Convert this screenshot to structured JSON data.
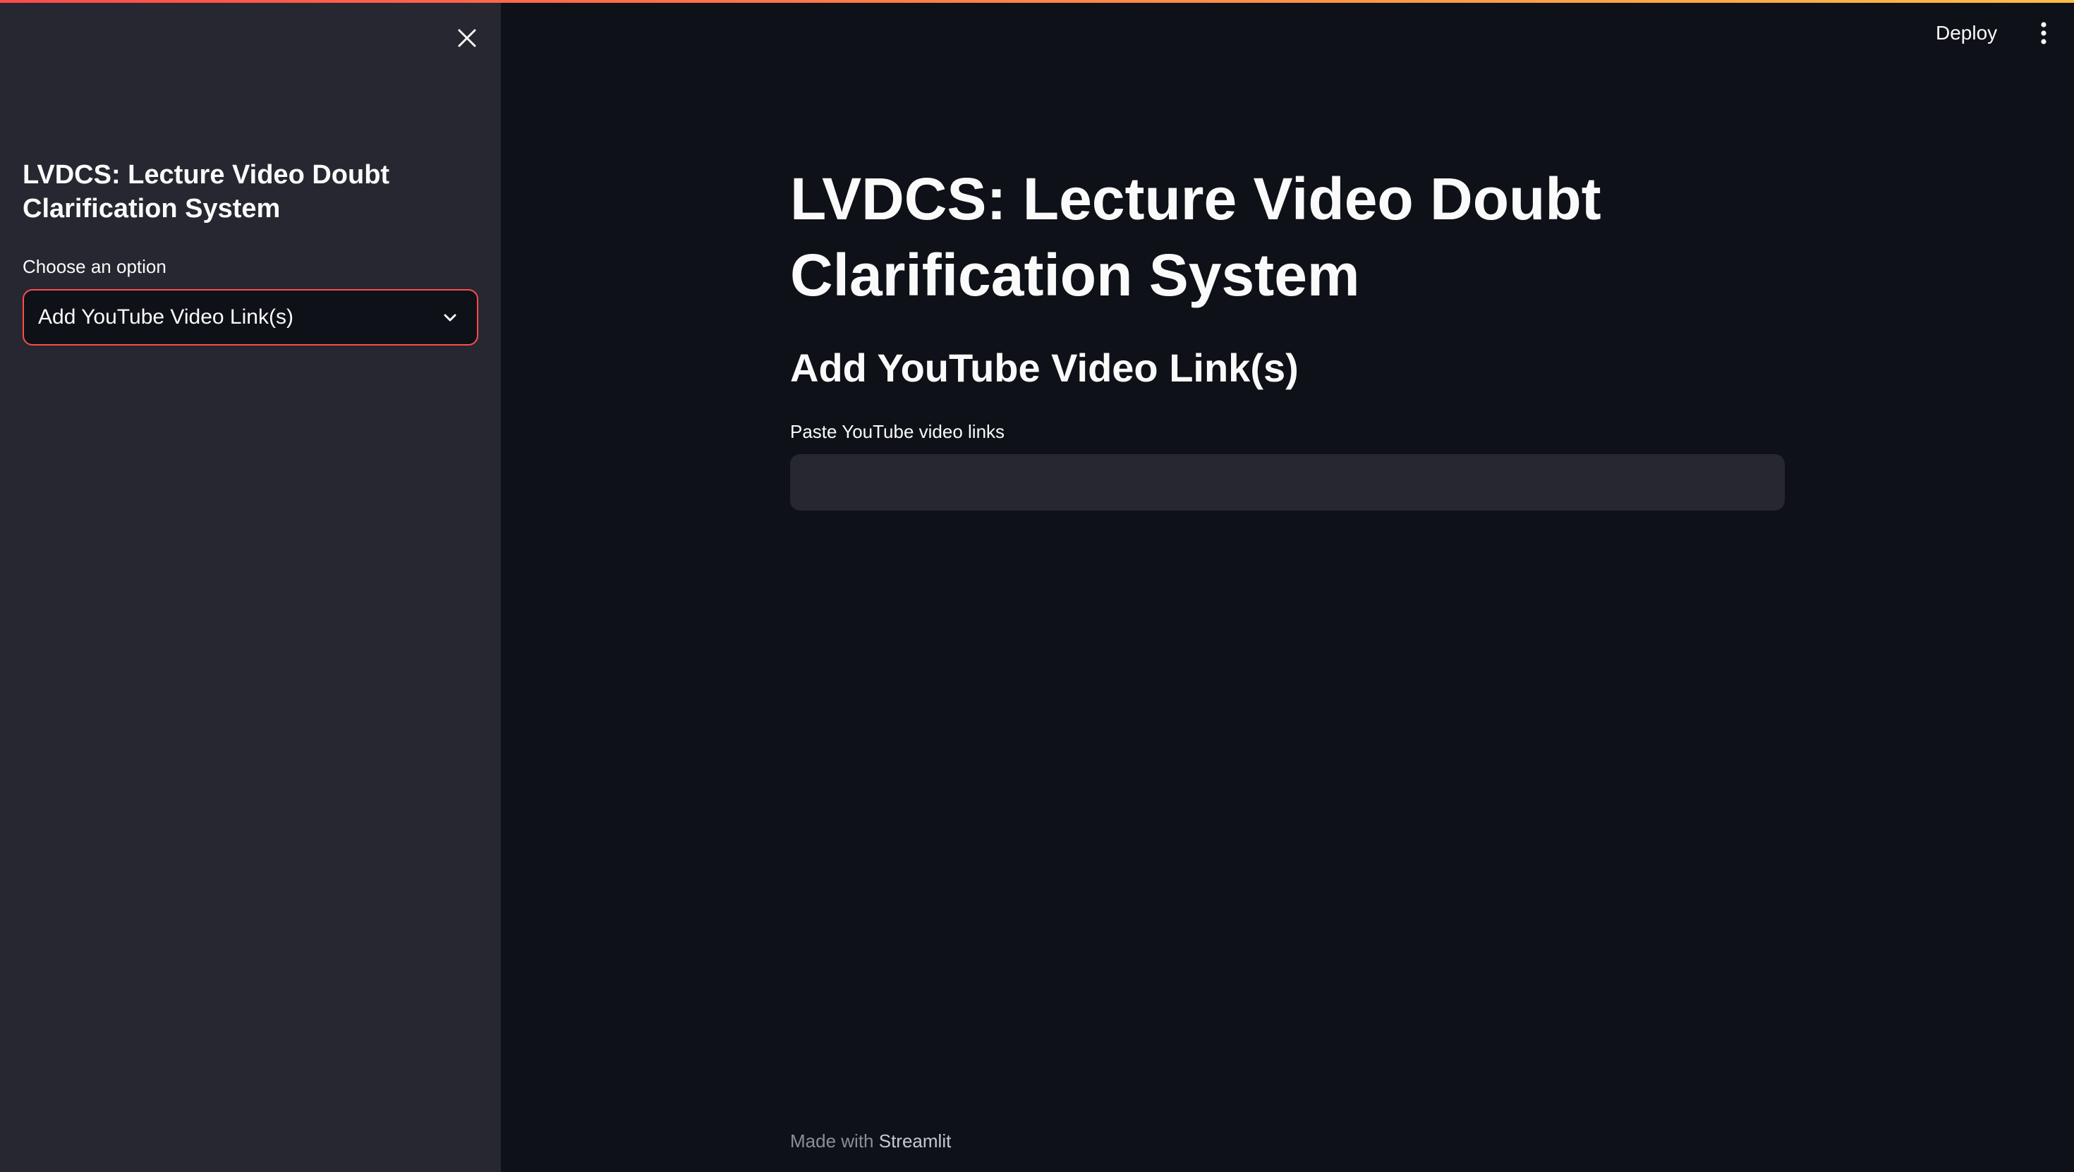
{
  "header": {
    "deploy_label": "Deploy",
    "menu_icon": "kebab-menu-icon",
    "accent_gradient": [
      "#ff4b4b",
      "#ffbd45"
    ]
  },
  "sidebar": {
    "close_icon": "close-icon",
    "title": "LVDCS: Lecture Video Doubt Clarification System",
    "select": {
      "label": "Choose an option",
      "selected": "Add YouTube Video Link(s)",
      "chevron_icon": "chevron-down-icon",
      "focus_color": "#ff4b4b"
    }
  },
  "main": {
    "title": "LVDCS: Lecture Video Doubt Clarification System",
    "section_header": "Add YouTube Video Link(s)",
    "input": {
      "label": "Paste YouTube video links",
      "value": "",
      "placeholder": ""
    }
  },
  "footer": {
    "prefix": "Made with ",
    "link": "Streamlit"
  },
  "colors": {
    "background": "#0e1117",
    "sidebar_background": "#262730",
    "text": "#fafafa",
    "muted_text": "#8b8d98"
  }
}
